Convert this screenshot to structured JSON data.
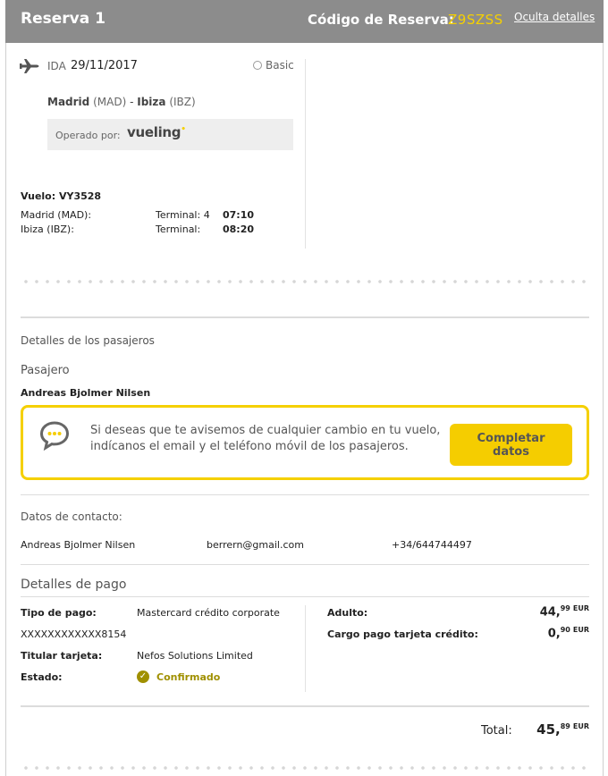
{
  "header": {
    "title": "Reserva 1",
    "code_label": "Código de Reserva:",
    "code": "Z9SZSS",
    "hide_link": "Oculta detalles"
  },
  "flight": {
    "direction": "IDA",
    "date": "29/11/2017",
    "fare": "Basic",
    "origin_city": "Madrid",
    "origin_code": "(MAD)",
    "route_sep": "-",
    "dest_city": "Ibiza",
    "dest_code": "(IBZ)",
    "operated_by": "Operado por:",
    "carrier_logo": "vueling",
    "flight_label": "Vuelo: VY3528",
    "segments": [
      {
        "airport": "Madrid (MAD):",
        "terminal": "Terminal: 4",
        "time": "07:10"
      },
      {
        "airport": "Ibiza (IBZ):",
        "terminal": "Terminal:",
        "time": "08:20"
      }
    ]
  },
  "passengers": {
    "section_title": "Detalles de los pasajeros",
    "subtitle": "Pasajero",
    "name": "Andreas Bjolmer Nilsen",
    "notice_text": "Si deseas que te avisemos de cualquier cambio en tu vuelo, indícanos el email y el teléfono móvil de los pasajeros.",
    "cta_label": "Completar datos"
  },
  "contact": {
    "title": "Datos de contacto:",
    "name": "Andreas Bjolmer Nilsen",
    "email": "berrern@gmail.com",
    "phone": "+34/644744497"
  },
  "payment": {
    "title": "Detalles de pago",
    "type_label": "Tipo de pago:",
    "type_value": "Mastercard crédito corporate",
    "card_number": "XXXXXXXXXXXX8154",
    "holder_label": "Titular tarjeta:",
    "holder_value": "Nefos Solutions Limited",
    "status_label": "Estado:",
    "status_value": "Confirmado",
    "lines": [
      {
        "label": "Adulto:",
        "int": "44,",
        "dec": "99",
        "unit": "EUR"
      },
      {
        "label": "Cargo pago tarjeta crédito:",
        "int": "0,",
        "dec": "90",
        "unit": "EUR"
      }
    ],
    "total_label": "Total:",
    "total_int": "45,",
    "total_dec": "89",
    "total_unit": "EUR"
  },
  "colors": {
    "header_bg": "#8c8c8c",
    "accent": "#f5d000",
    "confirmed": "#a09000"
  }
}
